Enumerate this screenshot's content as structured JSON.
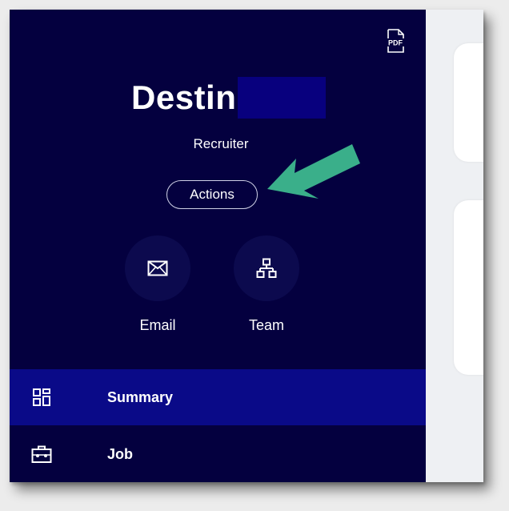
{
  "profile": {
    "name": "Destin",
    "role": "Recruiter",
    "actions_label": "Actions",
    "pdf_label": "PDF"
  },
  "quick_actions": [
    {
      "label": "Email",
      "icon": "envelope-icon"
    },
    {
      "label": "Team",
      "icon": "org-chart-icon"
    }
  ],
  "nav": [
    {
      "label": "Summary",
      "icon": "grid-icon",
      "active": true
    },
    {
      "label": "Job",
      "icon": "briefcase-icon",
      "active": false
    }
  ],
  "colors": {
    "sidebar_bg": "#04003f",
    "active_nav_bg": "#0a0a88",
    "redaction": "#08007e",
    "annotation_arrow": "#3aaf8a"
  }
}
